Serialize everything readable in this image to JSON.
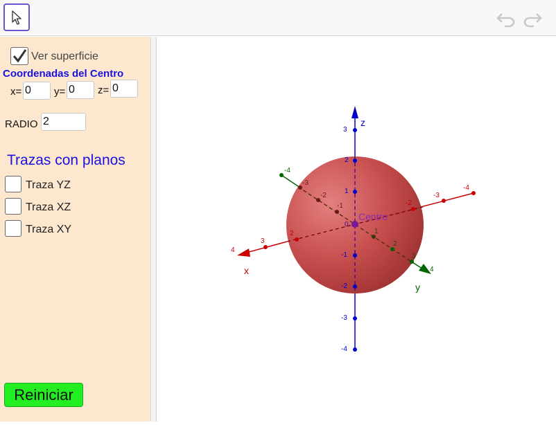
{
  "toolbar": {
    "tool_icon": "move-arrow-icon",
    "undo_icon": "undo-icon",
    "redo_icon": "redo-icon"
  },
  "panel": {
    "show_surface": {
      "label": "Ver superficie",
      "checked": true
    },
    "center_heading": "Coordenadas del Centro",
    "center": {
      "x_label": "x=",
      "x_value": "0",
      "y_label": "y=",
      "y_value": "0",
      "z_label": "z=",
      "z_value": "0"
    },
    "radius": {
      "label": "RADIO",
      "value": "2"
    },
    "traces_title": "Trazas con planos",
    "traces": [
      {
        "label": "Traza YZ",
        "checked": false
      },
      {
        "label": "Traza XZ",
        "checked": false
      },
      {
        "label": "Traza XY",
        "checked": false
      }
    ],
    "reset_label": "Reiniciar"
  },
  "graphics": {
    "center_label": "Centro",
    "origin_label": "0",
    "axes": {
      "x": {
        "label": "x",
        "color": "#cc0000",
        "ticks": [
          {
            "t": "4"
          },
          {
            "t": "3"
          },
          {
            "t": "2"
          },
          {
            "t": "-2"
          },
          {
            "t": "-3"
          },
          {
            "t": "-4"
          }
        ]
      },
      "y": {
        "label": "y",
        "color": "#006600",
        "ticks": [
          {
            "t": "-4"
          },
          {
            "t": "-3"
          },
          {
            "t": "-2"
          },
          {
            "t": "-1"
          },
          {
            "t": "1"
          },
          {
            "t": "2"
          },
          {
            "t": "3"
          },
          {
            "t": "4"
          }
        ]
      },
      "z": {
        "label": "z",
        "color": "#0000cc",
        "ticks": [
          {
            "t": "3"
          },
          {
            "t": "2"
          },
          {
            "t": "1"
          },
          {
            "t": "-1"
          },
          {
            "t": "-2"
          },
          {
            "t": "-3"
          },
          {
            "t": "-4"
          }
        ]
      }
    },
    "sphere_color": "#c03a3a"
  }
}
